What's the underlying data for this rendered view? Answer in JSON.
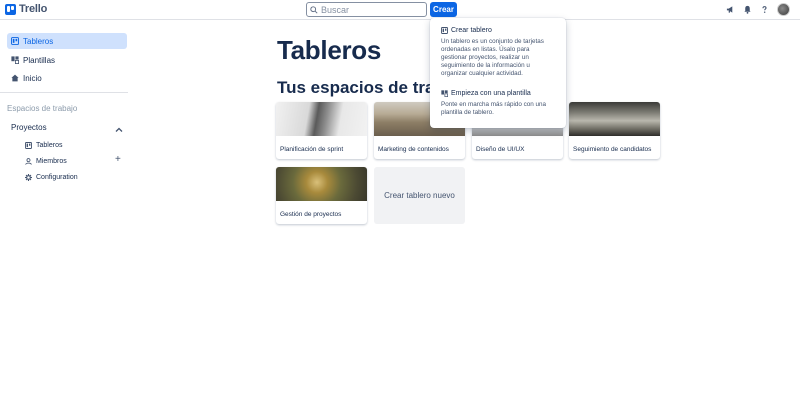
{
  "header": {
    "logo_text": "Trello",
    "search_placeholder": "Buscar",
    "create_label": "Crear",
    "icons": [
      "megaphone-icon",
      "bell-icon",
      "help-icon"
    ]
  },
  "sidebar": {
    "nav": [
      {
        "label": "Tableros",
        "icon": "board-icon",
        "active": true
      },
      {
        "label": "Plantillas",
        "icon": "template-icon",
        "active": false
      },
      {
        "label": "Inicio",
        "icon": "home-icon",
        "active": false
      }
    ],
    "workspaces_heading": "Espacios de trabajo",
    "workspace": {
      "name": "Proyectos",
      "items": [
        {
          "label": "Tableros",
          "icon": "board-icon"
        },
        {
          "label": "Miembros",
          "icon": "person-icon"
        },
        {
          "label": "Configuration",
          "icon": "gear-icon"
        }
      ]
    }
  },
  "main": {
    "page_title": "Tableros",
    "section_title": "Tus espacios de trabajo",
    "boards": [
      {
        "name": "Planificación de sprint"
      },
      {
        "name": "Marketing de contenidos"
      },
      {
        "name": "Diseño de UI/UX"
      },
      {
        "name": "Seguimiento de candidatos"
      },
      {
        "name": "Gestión de proyectos"
      }
    ],
    "new_board_label": "Crear tablero nuevo"
  },
  "create_menu": {
    "items": [
      {
        "title": "Crear tablero",
        "description": "Un tablero es un conjunto de tarjetas ordenadas en listas. Úsalo para gestionar proyectos, realizar un seguimiento de la información u organizar cualquier actividad."
      },
      {
        "title": "Empieza con una plantilla",
        "description": "Ponte en marcha más rápido con una plantilla de tablero."
      }
    ]
  },
  "colors": {
    "accent": "#0c66e4",
    "active_bg": "#cfe1fd",
    "text": "#172b4d",
    "muted": "#44546f"
  }
}
